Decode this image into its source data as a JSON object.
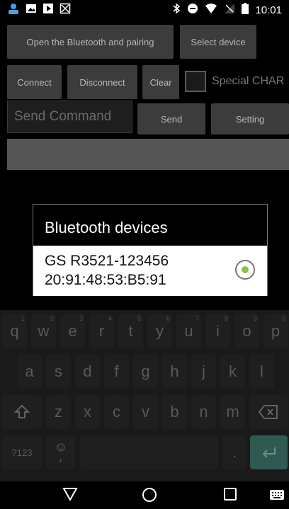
{
  "status_bar": {
    "time": "10:01",
    "icons": [
      "app-notification-icon",
      "image-notification-icon",
      "play-notification-icon",
      "x-box-icon",
      "bluetooth-icon",
      "do-not-disturb-icon",
      "wifi-icon",
      "no-signal-icon",
      "battery-icon"
    ]
  },
  "app": {
    "open_pair_label": "Open the Bluetooth and pairing",
    "select_device_label": "Select device",
    "connect_label": "Connect",
    "disconnect_label": "Disconnect",
    "clear_label": "Clear",
    "special_char_label": "Special CHAR",
    "send_command_placeholder": "Send Command",
    "send_label": "Send",
    "setting_label": "Setting"
  },
  "dialog": {
    "title": "Bluetooth devices",
    "devices": [
      {
        "name": "GS R3521-123456",
        "mac": "20:91:48:53:B5:91",
        "selected": true
      }
    ]
  },
  "keyboard": {
    "row1": [
      {
        "k": "q",
        "h": "1"
      },
      {
        "k": "w",
        "h": "2"
      },
      {
        "k": "e",
        "h": "3"
      },
      {
        "k": "r",
        "h": "4"
      },
      {
        "k": "t",
        "h": "5"
      },
      {
        "k": "y",
        "h": "6"
      },
      {
        "k": "u",
        "h": "7"
      },
      {
        "k": "i",
        "h": "8"
      },
      {
        "k": "o",
        "h": "9"
      },
      {
        "k": "p",
        "h": "0"
      }
    ],
    "row2": [
      "a",
      "s",
      "d",
      "f",
      "g",
      "h",
      "j",
      "k",
      "l"
    ],
    "row3": [
      "z",
      "x",
      "c",
      "v",
      "b",
      "n",
      "m"
    ],
    "symbols_label": "?123",
    "comma_label": ",",
    "period_label": "."
  },
  "colors": {
    "accent": "#8bc34a",
    "enter_key": "#2e5a52"
  }
}
